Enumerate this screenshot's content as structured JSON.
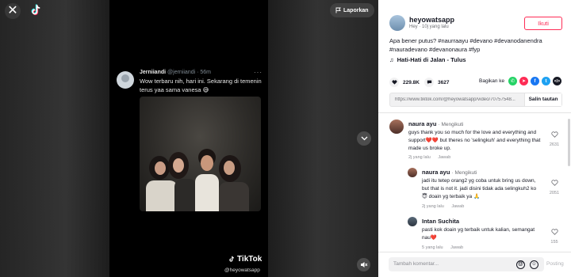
{
  "video": {
    "report_label": "Laporkan",
    "tweet": {
      "name": "Jerniiandi",
      "handle": "@jerniiandi",
      "time": "· 56m",
      "text": "Wow terbaru nih, hari ini. Sekarang di temenin terus yaa sama vanesa 😅"
    },
    "watermark_brand": "TikTok",
    "watermark_user": "@heyowatsapp"
  },
  "post": {
    "author": "heyowatsapp",
    "meta": "Hey · 10j yang lalu",
    "follow_label": "Ikuti",
    "caption": "Apa bener putus? #naurraayu #devano #devanodanendra #nauradevano #devanonaura #fyp",
    "music": "Hati-Hati di Jalan - Tulus",
    "likes": "229.8K",
    "comments": "3627",
    "share_label": "Bagikan ke",
    "link": "https://www.tiktok.com/@heyowatsapp/video/70757548...",
    "copy_label": "Salin tautan"
  },
  "comments": [
    {
      "user": "naura ayu",
      "badge": "· Mengikuti",
      "text": "guys thank you so much for the love and everything and support❤️❤️ but theres no 'selingkuh' and everything that made us broke up.",
      "time": "2j yang lalu",
      "reply": "Jawab",
      "likes": "2631"
    },
    {
      "user": "naura ayu",
      "badge": "· Mengikuti",
      "text": "jadi itu tetep orang2 yg coba untuk bring us down, but that is not it. jadi disini tidak ada selingkuh2 ko 😇 doain yg terbaik ya 🙏",
      "time": "2j yang lalu",
      "reply": "Jawab",
      "likes": "2051"
    },
    {
      "user": "Intan Suchita",
      "badge": "",
      "text": "pasti kok doain yg terbaik untuk kalian, semangat nau❤️",
      "time": "5 yang lalu",
      "reply": "Jawab",
      "likes": "155"
    }
  ],
  "composer": {
    "placeholder": "Tambah komentar...",
    "post_label": "Posting"
  },
  "colors": {
    "accent": "#fe2c55",
    "whatsapp": "#25d366",
    "facebook": "#1877f2",
    "twitter": "#1da1f2",
    "embed": "#161823"
  }
}
